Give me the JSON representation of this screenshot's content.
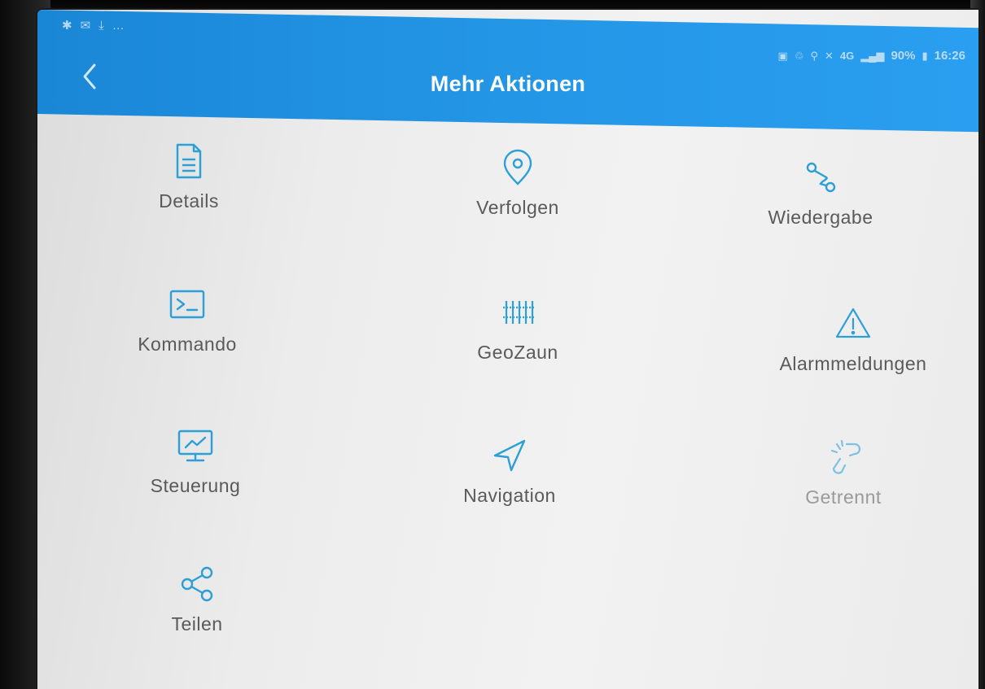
{
  "status_bar": {
    "battery": "90%",
    "time": "16:26",
    "network": "4G"
  },
  "header": {
    "title": "Mehr Aktionen",
    "back_icon": "chevron-left-icon"
  },
  "colors": {
    "appbar": "#2496e6",
    "icon_accent": "#2b9fd6",
    "label": "#5a5a5a",
    "label_disabled": "#9a9a9a"
  },
  "actions": [
    {
      "label": "Details",
      "icon": "document-icon",
      "enabled": true
    },
    {
      "label": "Verfolgen",
      "icon": "location-pin-icon",
      "enabled": true
    },
    {
      "label": "Wiedergabe",
      "icon": "route-icon",
      "enabled": true
    },
    {
      "label": "Kommando",
      "icon": "terminal-icon",
      "enabled": true
    },
    {
      "label": "GeoZaun",
      "icon": "fence-icon",
      "enabled": true
    },
    {
      "label": "Alarmmeldungen",
      "icon": "warning-icon",
      "enabled": true
    },
    {
      "label": "Steuerung",
      "icon": "monitor-chart-icon",
      "enabled": true
    },
    {
      "label": "Navigation",
      "icon": "navigation-arrow-icon",
      "enabled": true
    },
    {
      "label": "Getrennt",
      "icon": "unlink-icon",
      "enabled": false
    },
    {
      "label": "Teilen",
      "icon": "share-icon",
      "enabled": true
    }
  ]
}
